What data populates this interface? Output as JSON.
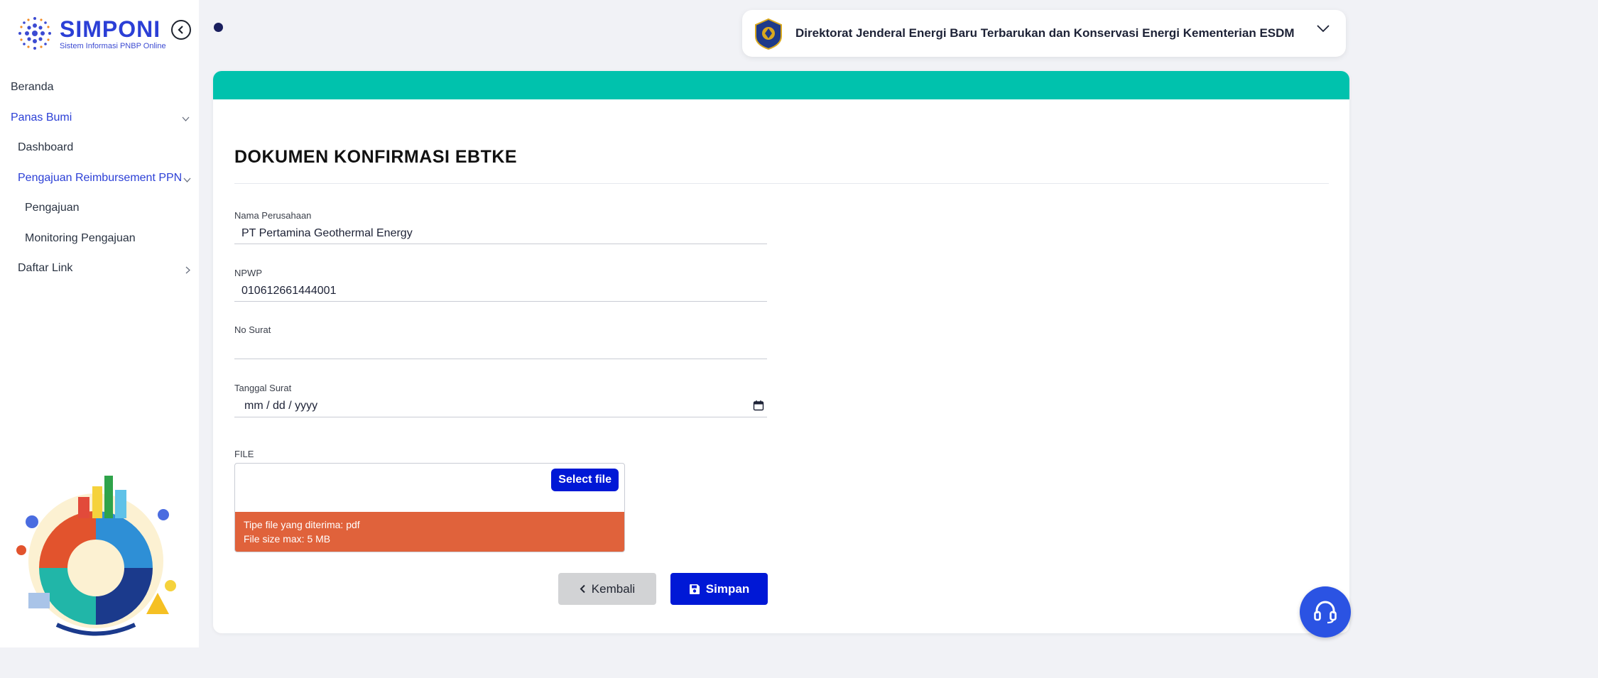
{
  "brand": {
    "name": "SIMPONI",
    "subtitle": "Sistem Informasi PNBP Online"
  },
  "sidebar": {
    "items": [
      {
        "label": "Beranda"
      },
      {
        "label": "Panas Bumi"
      },
      {
        "label": "Dashboard"
      },
      {
        "label": "Pengajuan Reimbursement PPN"
      },
      {
        "label": "Pengajuan"
      },
      {
        "label": "Monitoring Pengajuan"
      },
      {
        "label": "Daftar Link"
      }
    ]
  },
  "header": {
    "org_name": "Direktorat Jenderal Energi Baru Terbarukan dan Konservasi Energi Kementerian ESDM"
  },
  "form": {
    "title": "DOKUMEN KONFIRMASI EBTKE",
    "company": {
      "label": "Nama Perusahaan",
      "value": "PT Pertamina Geothermal Energy"
    },
    "npwp": {
      "label": "NPWP",
      "value": "010612661444001"
    },
    "no_surat": {
      "label": "No Surat",
      "value": ""
    },
    "tanggal": {
      "label": "Tanggal Surat",
      "placeholder": "mm / dd / yyyy"
    },
    "file": {
      "label": "FILE",
      "button": "Select file",
      "note_type": "Tipe file yang diterima: pdf",
      "note_size": "File size max: 5 MB"
    },
    "back_label": "Kembali",
    "save_label": "Simpan"
  },
  "colors": {
    "accent": "#00c2ad",
    "primary": "#0018d6",
    "warning": "#e0623b",
    "nav_active": "#2b3fd6"
  },
  "icons": [
    "chevron-left-circle-icon",
    "chevron-down-icon",
    "chevron-right-icon",
    "calendar-icon",
    "save-icon",
    "headset-icon"
  ]
}
